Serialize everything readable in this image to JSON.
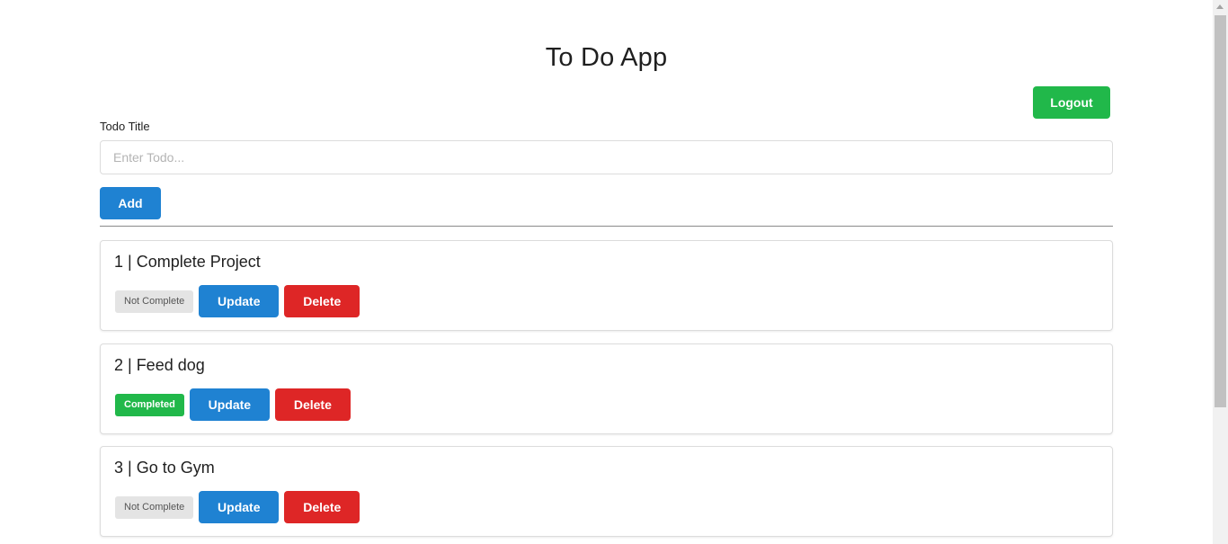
{
  "app": {
    "title": "To Do App"
  },
  "header": {
    "logout_label": "Logout"
  },
  "form": {
    "label": "Todo Title",
    "input_placeholder": "Enter Todo...",
    "input_value": "",
    "add_label": "Add"
  },
  "todos": [
    {
      "title": "1 | Complete Project",
      "status": "Not Complete",
      "completed": false,
      "update_label": "Update",
      "delete_label": "Delete"
    },
    {
      "title": "2 | Feed dog",
      "status": "Completed",
      "completed": true,
      "update_label": "Update",
      "delete_label": "Delete"
    },
    {
      "title": "3 | Go to Gym",
      "status": "Not Complete",
      "completed": false,
      "update_label": "Update",
      "delete_label": "Delete"
    }
  ],
  "colors": {
    "primary": "#1f82d2",
    "success": "#21b84a",
    "danger": "#de2626",
    "muted": "#e4e4e4"
  }
}
